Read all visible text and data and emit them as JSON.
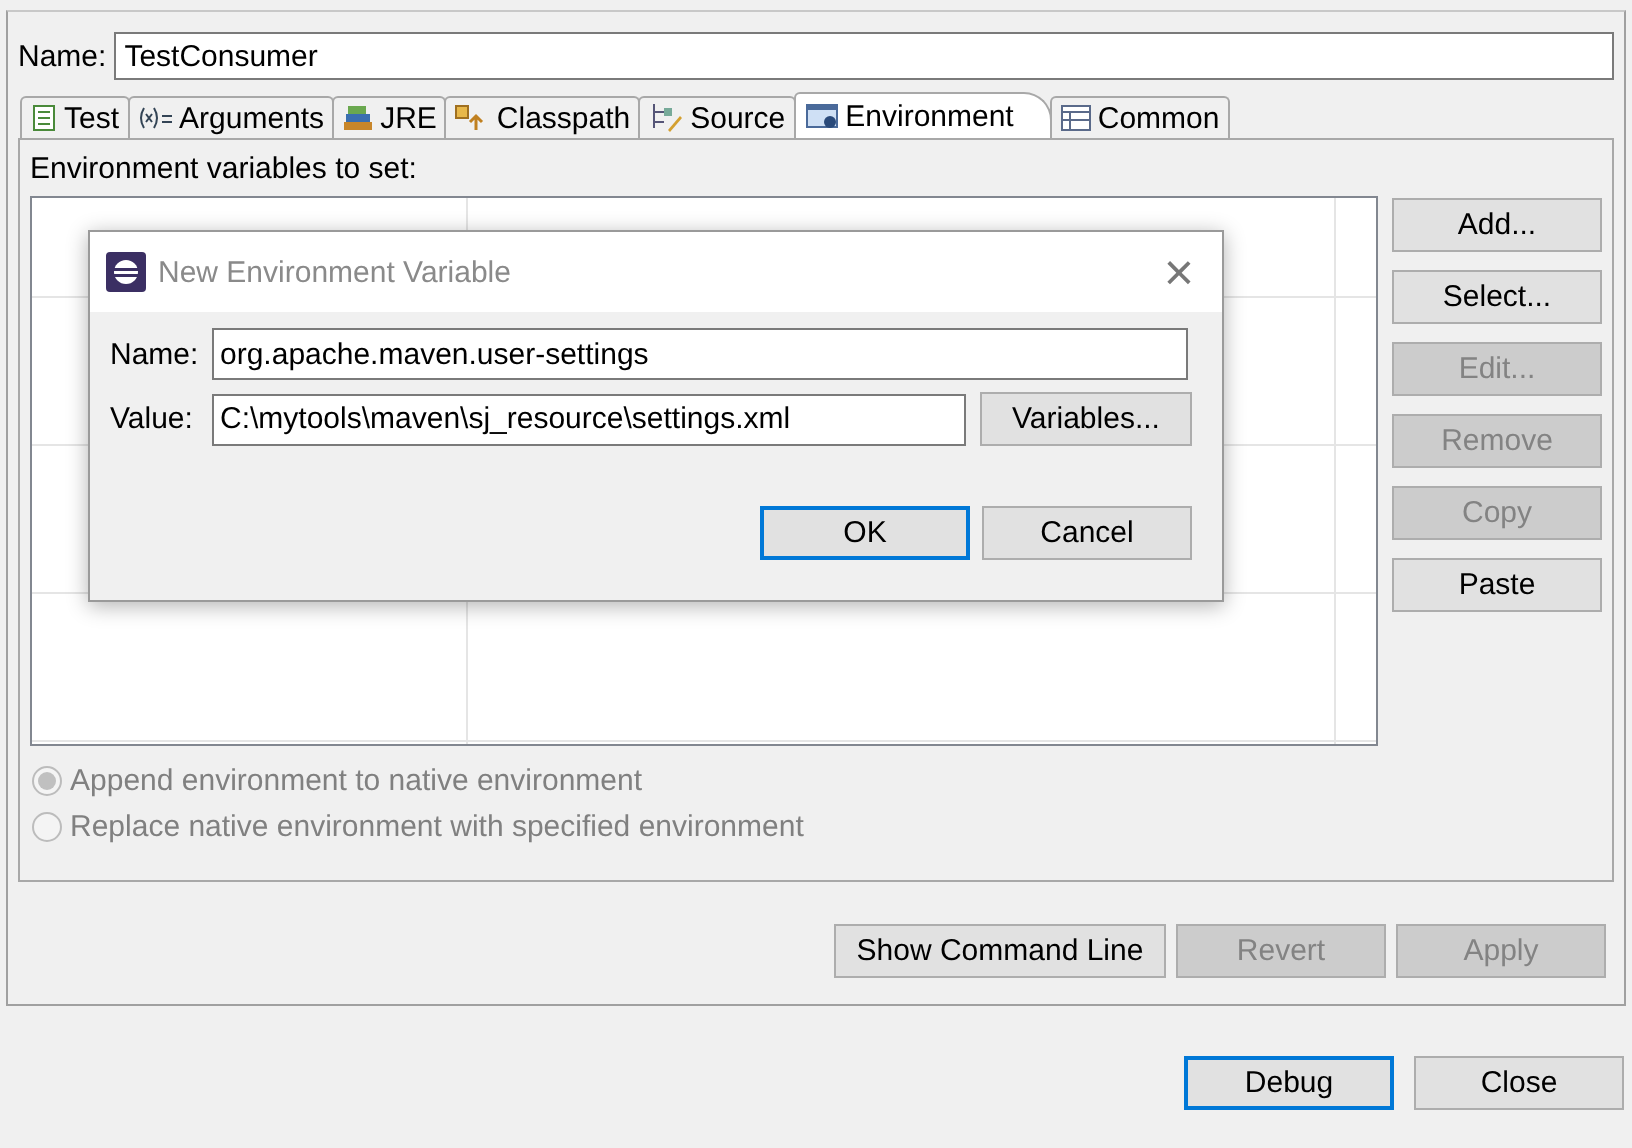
{
  "name_field": {
    "label": "Name:",
    "value": "TestConsumer"
  },
  "tabs": [
    {
      "label": "Test",
      "selected": false
    },
    {
      "label": "Arguments",
      "selected": false
    },
    {
      "label": "JRE",
      "selected": false
    },
    {
      "label": "Classpath",
      "selected": false
    },
    {
      "label": "Source",
      "selected": false
    },
    {
      "label": "Environment",
      "selected": true
    },
    {
      "label": "Common",
      "selected": false
    }
  ],
  "env_label": "Environment variables to set:",
  "side_buttons": [
    {
      "label": "Add...",
      "disabled": false
    },
    {
      "label": "Select...",
      "disabled": false
    },
    {
      "label": "Edit...",
      "disabled": true
    },
    {
      "label": "Remove",
      "disabled": true
    },
    {
      "label": "Copy",
      "disabled": true
    },
    {
      "label": "Paste",
      "disabled": false
    }
  ],
  "radios": [
    {
      "label": "Append environment to native environment",
      "selected": true,
      "disabled": true
    },
    {
      "label": "Replace native environment with specified environment",
      "selected": false,
      "disabled": true
    }
  ],
  "panel_buttons": [
    {
      "label": "Show Command Line",
      "disabled": false
    },
    {
      "label": "Revert",
      "disabled": true
    },
    {
      "label": "Apply",
      "disabled": true
    }
  ],
  "dialog_buttons": [
    {
      "label": "Debug",
      "default": true
    },
    {
      "label": "Close",
      "default": false
    }
  ],
  "dialog": {
    "title": "New Environment Variable",
    "close": "×",
    "name": {
      "label": "Name:",
      "value": "org.apache.maven.user-settings"
    },
    "value": {
      "label": "Value:",
      "value": "C:\\mytools\\maven\\sj_resource\\settings.xml"
    },
    "variables_button": "Variables...",
    "buttons": [
      {
        "label": "OK",
        "default": true
      },
      {
        "label": "Cancel",
        "default": false
      }
    ]
  }
}
